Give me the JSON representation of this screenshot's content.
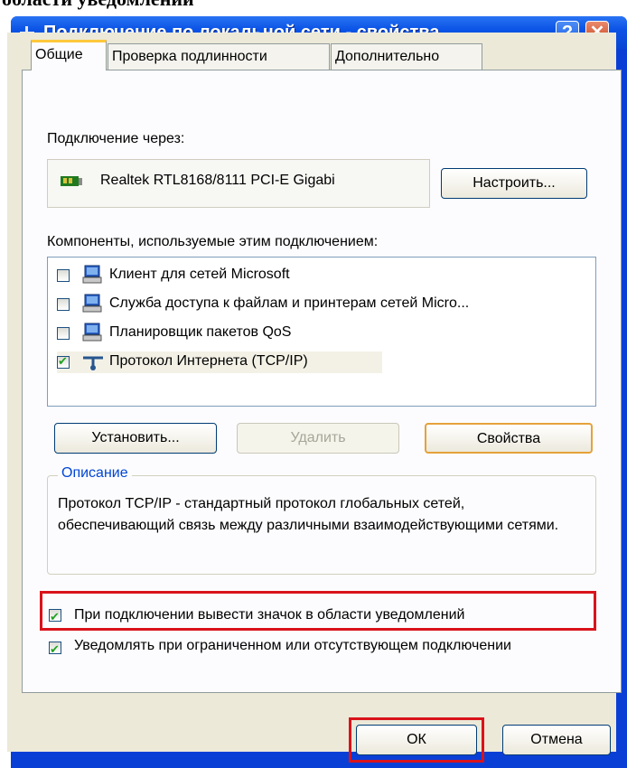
{
  "caption": "области уведомлений",
  "window": {
    "title": "Подключение по локальной сети - свойства",
    "help_symbol": "?",
    "close_symbol": "✕"
  },
  "tabs": [
    {
      "label": "Общие",
      "active": true
    },
    {
      "label": "Проверка подлинности",
      "active": false
    },
    {
      "label": "Дополнительно",
      "active": false
    }
  ],
  "connect_via": {
    "label": "Подключение через:",
    "adapter": "Realtek RTL8168/8111 PCI-E Gigabi",
    "configure_button": "Настроить..."
  },
  "components": {
    "label": "Компоненты, используемые этим подключением:",
    "items": [
      {
        "label": "Клиент для сетей Microsoft",
        "checked": false,
        "icon": "network-client-icon"
      },
      {
        "label": "Служба доступа к файлам и принтерам сетей Micro...",
        "checked": false,
        "icon": "network-service-icon"
      },
      {
        "label": "Планировщик пакетов QoS",
        "checked": false,
        "icon": "network-service-icon"
      },
      {
        "label": "Протокол Интернета (TCP/IP)",
        "checked": true,
        "icon": "protocol-icon"
      }
    ]
  },
  "buttons": {
    "install": "Установить...",
    "remove": "Удалить",
    "properties": "Свойства"
  },
  "description": {
    "legend": "Описание",
    "text": "Протокол TCP/IP - стандартный протокол глобальных сетей, обеспечивающий связь между различными взаимодействующими сетями."
  },
  "options": {
    "show_icon": {
      "label": "При подключении вывести значок в области уведомлений",
      "checked": true
    },
    "notify_limited": {
      "label": "Уведомлять при ограниченном или отсутствующем подключении",
      "checked": true
    }
  },
  "footer": {
    "ok": "ОК",
    "cancel": "Отмена"
  },
  "colors": {
    "titlebar": "#0b54e6",
    "highlight": "#d9131b",
    "legend_text": "#0046d5"
  }
}
